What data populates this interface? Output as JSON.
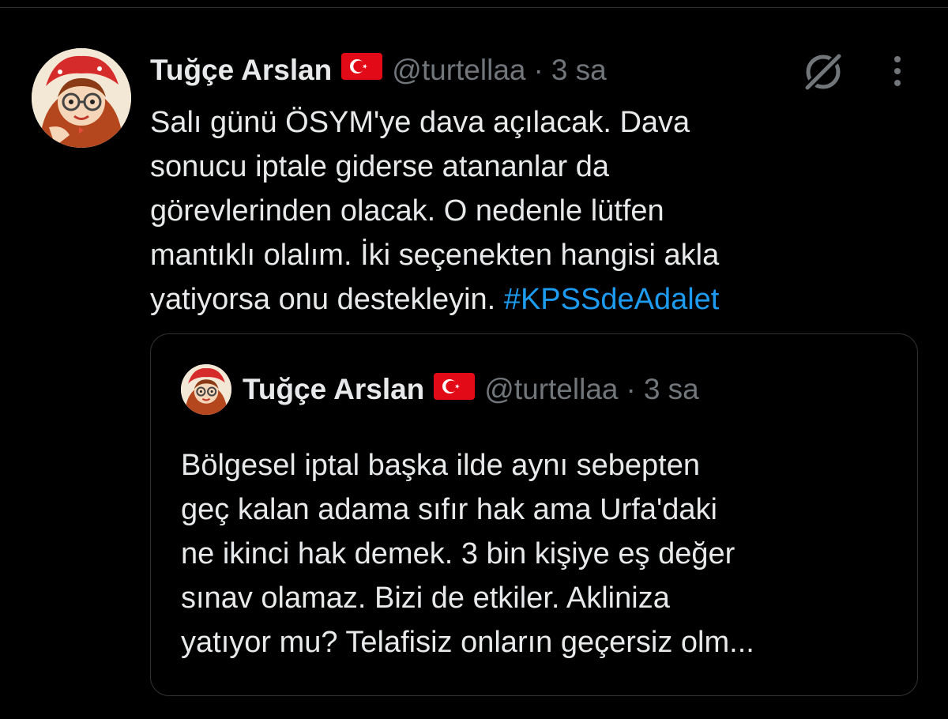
{
  "tweet": {
    "author_name": "Tuğçe Arslan",
    "flag_icon": "turkey-flag-icon",
    "handle": "@turtellaa",
    "separator": "·",
    "time": "3 sa",
    "text_lines": [
      "Salı günü ÖSYM'ye dava açılacak. Dava",
      "sonucu iptale giderse atananlar da",
      "görevlerinden olacak. O nedenle lütfen",
      "mantıklı olalım. İki seçenekten hangisi akla"
    ],
    "last_line_text": "yatiyorsa onu destekleyin.",
    "hashtag": "#KPSSdeAdalet",
    "actions": {
      "grok_icon": "grok-icon",
      "more_icon": "more-vertical-icon"
    }
  },
  "quoted_tweet": {
    "author_name": "Tuğçe Arslan",
    "flag_icon": "turkey-flag-icon",
    "handle": "@turtellaa",
    "separator": "·",
    "time": "3 sa",
    "text_lines": [
      "Bölgesel iptal başka ilde aynı sebepten",
      "geç kalan adama sıfır hak ama Urfa'daki",
      "ne ikinci hak demek. 3 bin kişiye eş değer",
      "sınav olamaz. Bizi de etkiler. Akliniza",
      "yatıyor mu? Telafisiz onların geçersiz olm..."
    ]
  },
  "colors": {
    "background": "#000000",
    "text_primary": "#e7e9ea",
    "text_secondary": "#71767b",
    "link": "#1d9bf0",
    "border": "#2f3336",
    "flag_red": "#e30a17"
  }
}
